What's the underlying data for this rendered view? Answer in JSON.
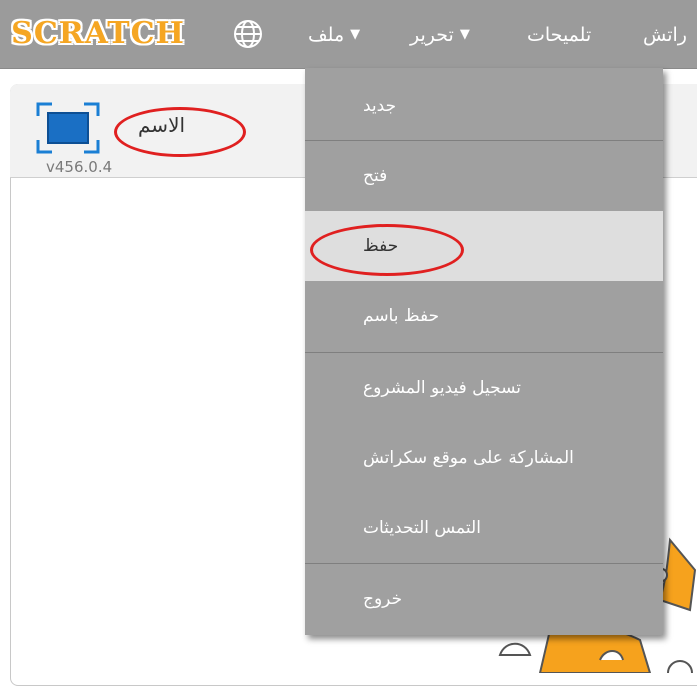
{
  "topbar": {
    "logo_text": "SCRATCH",
    "menu": {
      "file": "ملف",
      "edit": "تحرير",
      "tips": "تلميحات",
      "about": "راتش"
    }
  },
  "stage": {
    "project_name": "الاسم",
    "version": "v456.0.4"
  },
  "file_menu": {
    "items": [
      {
        "label": "جديد"
      },
      {
        "label": "فتح"
      },
      {
        "label": "حفظ",
        "highlighted": true
      },
      {
        "label": "حفظ باسم"
      },
      {
        "label": "تسجيل فيديو المشروع"
      },
      {
        "label": "المشاركة على موقع سكراتش"
      },
      {
        "label": "التمس التحديثات"
      },
      {
        "label": "خروج"
      }
    ]
  },
  "colors": {
    "menubar": "#9b9b9b",
    "dropdown": "#a0a0a0",
    "dropdown_highlight": "#dedede",
    "annotation": "#e02020",
    "logo": "#f5a623"
  },
  "icons": [
    "globe-icon",
    "fullscreen-icon",
    "dropdown-arrow-icon"
  ]
}
